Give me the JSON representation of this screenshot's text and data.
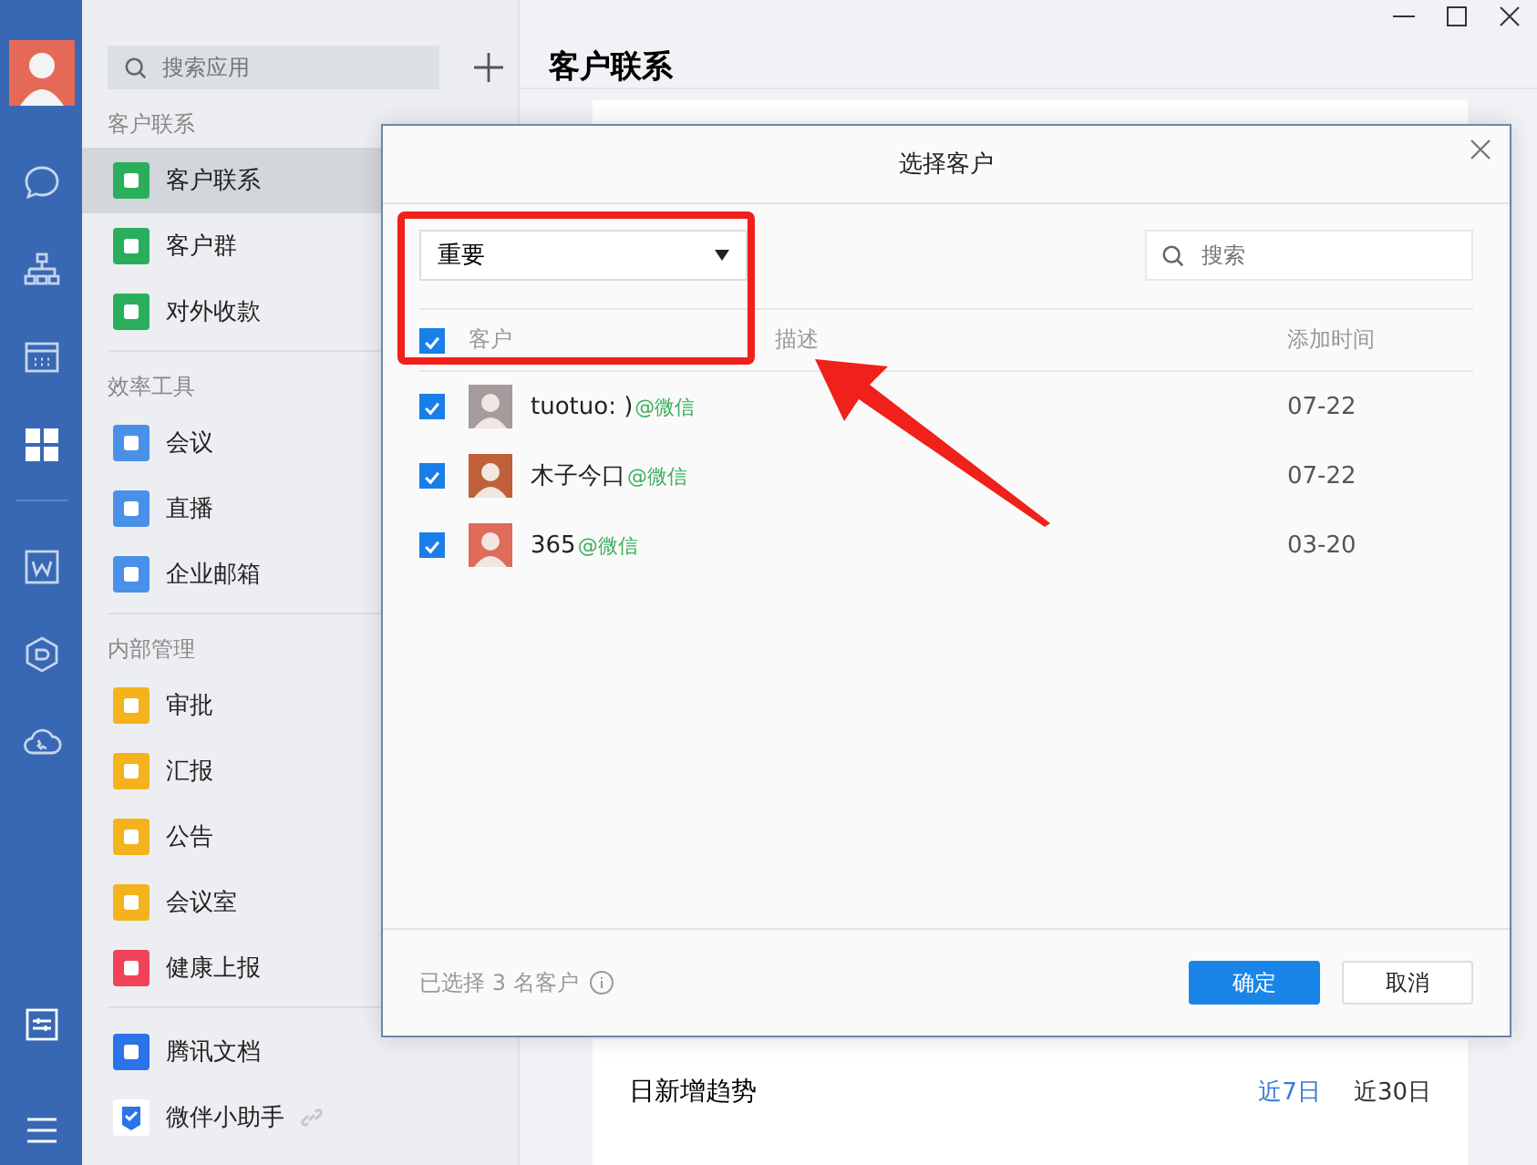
{
  "rail": {
    "items": [
      {
        "selected": false
      },
      {
        "selected": false
      },
      {
        "selected": false
      },
      {
        "selected": true
      },
      {
        "selected": false
      },
      {
        "selected": false
      },
      {
        "selected": false
      }
    ]
  },
  "sidebar": {
    "search": {
      "placeholder": "搜索应用"
    },
    "sections": [
      {
        "heading": "客户联系",
        "items": [
          {
            "label": "客户联系",
            "selected": true,
            "color": "#2bae5b",
            "linked": false
          },
          {
            "label": "客户群",
            "selected": false,
            "color": "#2bae5b",
            "linked": false
          },
          {
            "label": "对外收款",
            "selected": false,
            "color": "#2bae5b",
            "linked": false
          }
        ]
      },
      {
        "heading": "效率工具",
        "items": [
          {
            "label": "会议",
            "selected": false,
            "color": "#4a90e8",
            "linked": false
          },
          {
            "label": "直播",
            "selected": false,
            "color": "#4a90e8",
            "linked": false
          },
          {
            "label": "企业邮箱",
            "selected": false,
            "color": "#4a90e8",
            "linked": false
          }
        ]
      },
      {
        "heading": "内部管理",
        "items": [
          {
            "label": "审批",
            "selected": false,
            "color": "#f4b31d",
            "linked": false
          },
          {
            "label": "汇报",
            "selected": false,
            "color": "#f4b31d",
            "linked": false
          },
          {
            "label": "公告",
            "selected": false,
            "color": "#f4b31d",
            "linked": false
          },
          {
            "label": "会议室",
            "selected": false,
            "color": "#f4b31d",
            "linked": false
          },
          {
            "label": "健康上报",
            "selected": false,
            "color": "#f0435a",
            "linked": false
          }
        ]
      },
      {
        "items": [
          {
            "label": "腾讯文档",
            "selected": false,
            "color": "#2a73e8",
            "linked": false
          },
          {
            "label": "微伴小助手",
            "selected": false,
            "color": "#ffffff",
            "linked": true
          }
        ]
      }
    ]
  },
  "main": {
    "title": "客户联系",
    "trend": {
      "title": "日新增趋势",
      "ranges": [
        {
          "label": "近7日",
          "selected": true
        },
        {
          "label": "近30日",
          "selected": false
        }
      ]
    }
  },
  "dialog": {
    "title": "选择客户",
    "filter": {
      "value": "重要"
    },
    "search": {
      "placeholder": "搜索"
    },
    "select_all": {
      "checked": true
    },
    "columns": [
      "客户",
      "描述",
      "添加时间"
    ],
    "rows": [
      {
        "checked": true,
        "name": "tuotuo: )",
        "source": "@微信",
        "added": "07-22"
      },
      {
        "checked": true,
        "name": "木子今口",
        "source": "@微信",
        "added": "07-22"
      },
      {
        "checked": true,
        "name": "365",
        "source": "@微信",
        "added": "03-20"
      }
    ],
    "footer": {
      "summary": "已选择 3 名客户",
      "buttons": [
        {
          "label": "确定",
          "kind": "primary"
        },
        {
          "label": "取消",
          "kind": "secondary"
        }
      ]
    }
  }
}
